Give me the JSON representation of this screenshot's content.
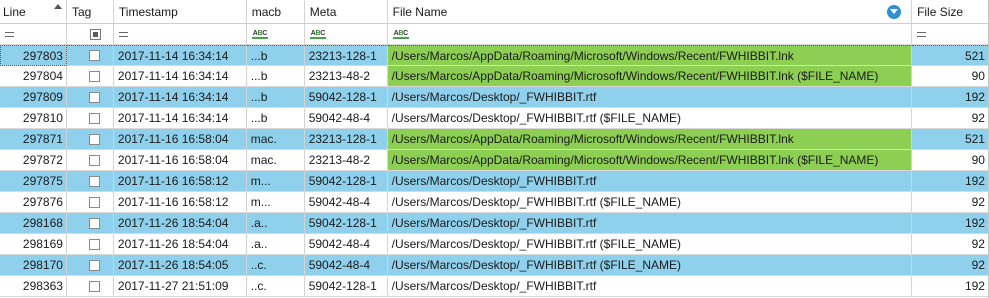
{
  "columns": {
    "line": "Line",
    "tag": "Tag",
    "timestamp": "Timestamp",
    "macb": "macb",
    "meta": "Meta",
    "file_name": "File Name",
    "file_size": "File Size"
  },
  "colors": {
    "row_blue": "#8fd1ed",
    "highlight_green": "#8dcf52",
    "filter_icon": "#2f8fd0"
  },
  "rows": [
    {
      "line": "297803",
      "timestamp": "2017-11-14 16:34:14",
      "macb": "...b",
      "meta": "23213-128-1",
      "file_name": "/Users/Marcos/AppData/Roaming/Microsoft/Windows/Recent/FWHIBBIT.lnk",
      "file_size": "521",
      "shade": "blue",
      "highlight": true
    },
    {
      "line": "297804",
      "timestamp": "2017-11-14 16:34:14",
      "macb": "...b",
      "meta": "23213-48-2",
      "file_name": "/Users/Marcos/AppData/Roaming/Microsoft/Windows/Recent/FWHIBBIT.lnk ($FILE_NAME)",
      "file_size": "90",
      "shade": "white",
      "highlight": true
    },
    {
      "line": "297809",
      "timestamp": "2017-11-14 16:34:14",
      "macb": "...b",
      "meta": "59042-128-1",
      "file_name": "/Users/Marcos/Desktop/_FWHIBBIT.rtf",
      "file_size": "192",
      "shade": "blue",
      "highlight": false
    },
    {
      "line": "297810",
      "timestamp": "2017-11-14 16:34:14",
      "macb": "...b",
      "meta": "59042-48-4",
      "file_name": "/Users/Marcos/Desktop/_FWHIBBIT.rtf ($FILE_NAME)",
      "file_size": "92",
      "shade": "white",
      "highlight": false
    },
    {
      "line": "297871",
      "timestamp": "2017-11-16 16:58:04",
      "macb": "mac.",
      "meta": "23213-128-1",
      "file_name": "/Users/Marcos/AppData/Roaming/Microsoft/Windows/Recent/FWHIBBIT.lnk",
      "file_size": "521",
      "shade": "blue",
      "highlight": true
    },
    {
      "line": "297872",
      "timestamp": "2017-11-16 16:58:04",
      "macb": "mac.",
      "meta": "23213-48-2",
      "file_name": "/Users/Marcos/AppData/Roaming/Microsoft/Windows/Recent/FWHIBBIT.lnk ($FILE_NAME)",
      "file_size": "90",
      "shade": "white",
      "highlight": true
    },
    {
      "line": "297875",
      "timestamp": "2017-11-16 16:58:12",
      "macb": "m...",
      "meta": "59042-128-1",
      "file_name": "/Users/Marcos/Desktop/_FWHIBBIT.rtf",
      "file_size": "192",
      "shade": "blue",
      "highlight": false
    },
    {
      "line": "297876",
      "timestamp": "2017-11-16 16:58:12",
      "macb": "m...",
      "meta": "59042-48-4",
      "file_name": "/Users/Marcos/Desktop/_FWHIBBIT.rtf ($FILE_NAME)",
      "file_size": "92",
      "shade": "white",
      "highlight": false
    },
    {
      "line": "298168",
      "timestamp": "2017-11-26 18:54:04",
      "macb": ".a..",
      "meta": "59042-128-1",
      "file_name": "/Users/Marcos/Desktop/_FWHIBBIT.rtf",
      "file_size": "192",
      "shade": "blue",
      "highlight": false
    },
    {
      "line": "298169",
      "timestamp": "2017-11-26 18:54:04",
      "macb": ".a..",
      "meta": "59042-48-4",
      "file_name": "/Users/Marcos/Desktop/_FWHIBBIT.rtf ($FILE_NAME)",
      "file_size": "92",
      "shade": "white",
      "highlight": false
    },
    {
      "line": "298170",
      "timestamp": "2017-11-26 18:54:05",
      "macb": "..c.",
      "meta": "59042-48-4",
      "file_name": "/Users/Marcos/Desktop/_FWHIBBIT.rtf ($FILE_NAME)",
      "file_size": "92",
      "shade": "blue",
      "highlight": false
    },
    {
      "line": "298363",
      "timestamp": "2017-11-27 21:51:09",
      "macb": "..c.",
      "meta": "59042-128-1",
      "file_name": "/Users/Marcos/Desktop/_FWHIBBIT.rtf",
      "file_size": "192",
      "shade": "white",
      "highlight": false
    }
  ]
}
